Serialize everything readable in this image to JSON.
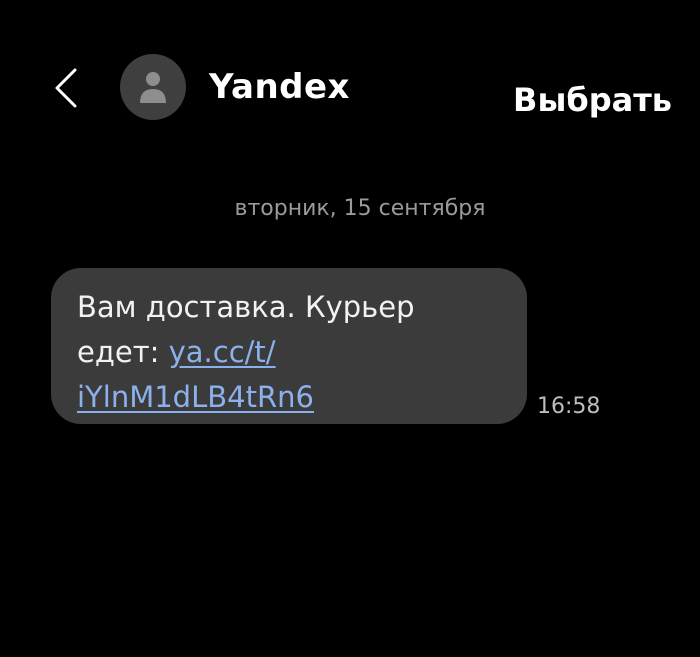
{
  "header": {
    "contact_name": "Yandex",
    "select_label": "Выбрать",
    "back_icon": "chevron-left-icon",
    "avatar_icon": "person-icon"
  },
  "conversation": {
    "date_separator": "вторник, 15 сентября",
    "messages": [
      {
        "text_line_1": "Вам доставка. Курьер",
        "text_line_2_prefix": "едет: ",
        "link_part_1": "ya.cc/t/",
        "link_part_2": "iYlnM1dLB4tRn6",
        "time": "16:58"
      }
    ]
  },
  "colors": {
    "background": "#000000",
    "bubble": "#3b3b3b",
    "link": "#8bb1ec",
    "secondary_text": "#9a9a9a"
  }
}
